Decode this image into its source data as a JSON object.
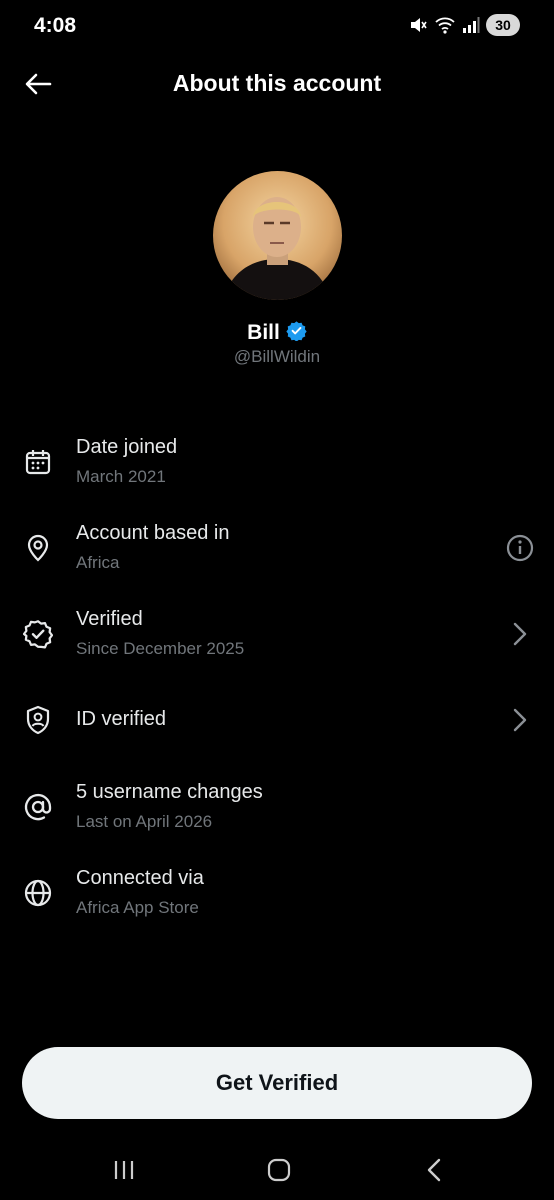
{
  "status_bar": {
    "time": "4:08",
    "battery": "30",
    "icons": [
      "mute-icon",
      "wifi-icon",
      "signal-icon",
      "battery-icon"
    ]
  },
  "header": {
    "title": "About this account",
    "back_icon": "arrow-left-icon"
  },
  "profile": {
    "name": "Bill",
    "handle": "@BillWildin",
    "verified_badge_color": "#1d9bf0"
  },
  "info_rows": [
    {
      "icon": "calendar-icon",
      "title": "Date joined",
      "subtitle": "March 2021",
      "trailing": ""
    },
    {
      "icon": "location-pin-icon",
      "title": "Account based in",
      "subtitle": "Africa",
      "trailing": "info-icon"
    },
    {
      "icon": "verified-badge-icon",
      "title": "Verified",
      "subtitle": "Since December 2025",
      "trailing": "chevron-right-icon"
    },
    {
      "icon": "id-shield-icon",
      "title": "ID verified",
      "subtitle": "",
      "trailing": "chevron-right-icon"
    },
    {
      "icon": "at-sign-icon",
      "title": "5 username changes",
      "subtitle": "Last on April 2026",
      "trailing": ""
    },
    {
      "icon": "globe-icon",
      "title": "Connected via",
      "subtitle": "Africa App Store",
      "trailing": ""
    }
  ],
  "cta": {
    "label": "Get Verified"
  },
  "nav_bar": {
    "icons": [
      "recents-icon",
      "home-icon",
      "back-icon"
    ]
  },
  "colors": {
    "background": "#000000",
    "primary_text": "#e7e9ea",
    "secondary_text": "#71767b",
    "button_bg": "#eff3f4",
    "accent": "#1d9bf0"
  }
}
